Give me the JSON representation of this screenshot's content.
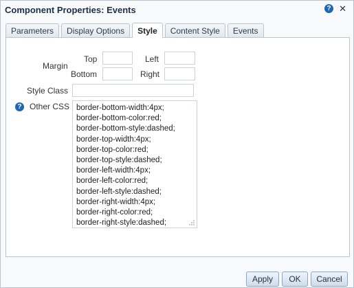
{
  "dialog": {
    "title": "Component Properties: Events",
    "help_icon": "help-icon",
    "close_icon": "close-icon",
    "close_glyph": "✕"
  },
  "tabs": [
    {
      "label": "Parameters",
      "active": false
    },
    {
      "label": "Display Options",
      "active": false
    },
    {
      "label": "Style",
      "active": true
    },
    {
      "label": "Content Style",
      "active": false
    },
    {
      "label": "Events",
      "active": false
    }
  ],
  "style_tab": {
    "margin_label": "Margin",
    "top_label": "Top",
    "left_label": "Left",
    "bottom_label": "Bottom",
    "right_label": "Right",
    "top_value": "",
    "left_value": "",
    "bottom_value": "",
    "right_value": "",
    "style_class_label": "Style Class",
    "style_class_value": "",
    "other_css_label": "Other CSS",
    "help_glyph": "?",
    "other_css_lines": [
      "border-bottom-width:4px;",
      "border-bottom-color:red;",
      "border-bottom-style:dashed;",
      "border-top-width:4px;",
      "border-top-color:red;",
      "border-top-style:dashed;",
      "border-left-width:4px;",
      "border-left-color:red;",
      "border-left-style:dashed;",
      "border-right-width:4px;",
      "border-right-color:red;",
      "border-right-style:dashed;"
    ]
  },
  "buttons": {
    "apply": "Apply",
    "ok": "OK",
    "cancel": "Cancel"
  },
  "colors": {
    "accent": "#1e66b6",
    "title_text": "#1f2f44"
  }
}
